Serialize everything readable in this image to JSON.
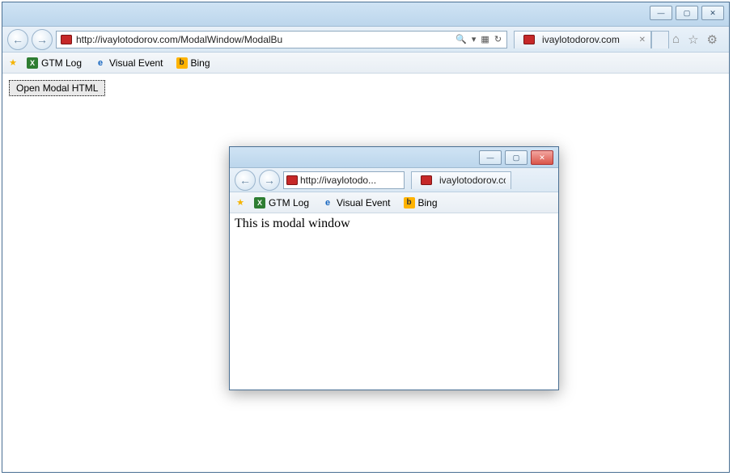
{
  "main": {
    "url": "http://ivaylotodorov.com/ModalWindow/ModalBu",
    "tab_title": "ivaylotodorov.com",
    "favbar": {
      "items": [
        {
          "label": "GTM Log"
        },
        {
          "label": "Visual Event"
        },
        {
          "label": "Bing"
        }
      ]
    },
    "page": {
      "button_label": "Open Modal HTML"
    }
  },
  "modal": {
    "url": "http://ivaylotodo...",
    "tab_title": "ivaylotodorov.com",
    "favbar": {
      "items": [
        {
          "label": "GTM Log"
        },
        {
          "label": "Visual Event"
        },
        {
          "label": "Bing"
        }
      ]
    },
    "body_text": "This is modal window"
  },
  "glyphs": {
    "search": "🔍",
    "dropdown": "▾",
    "refresh": "↻",
    "stop": "✕",
    "back": "←",
    "fwd": "→",
    "min": "—",
    "max": "▢",
    "close": "✕",
    "home": "⌂",
    "star": "☆",
    "gear": "⚙",
    "lock": "🔒"
  }
}
